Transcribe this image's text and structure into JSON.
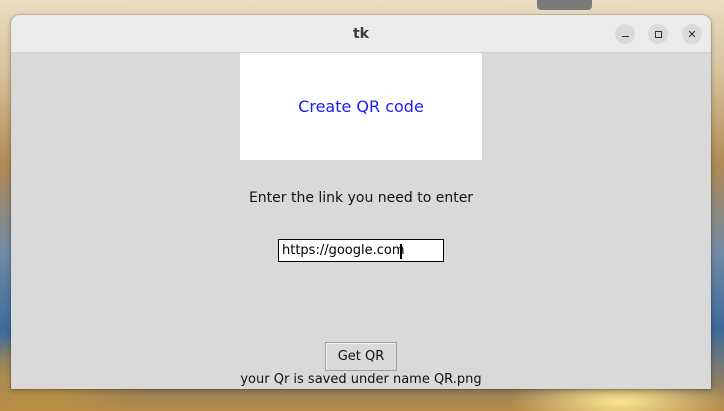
{
  "window": {
    "title": "tk",
    "controls": {
      "minimize": "minimize-icon",
      "maximize": "maximize-icon",
      "close": "close-icon"
    }
  },
  "app": {
    "header_text": "Create QR code",
    "header_color": "#1a1aff",
    "prompt_text": "Enter the link you need to enter",
    "link_input": {
      "value": "https://google.com"
    },
    "get_qr_label": "Get QR",
    "status_text": "your Qr is saved under name QR.png"
  }
}
